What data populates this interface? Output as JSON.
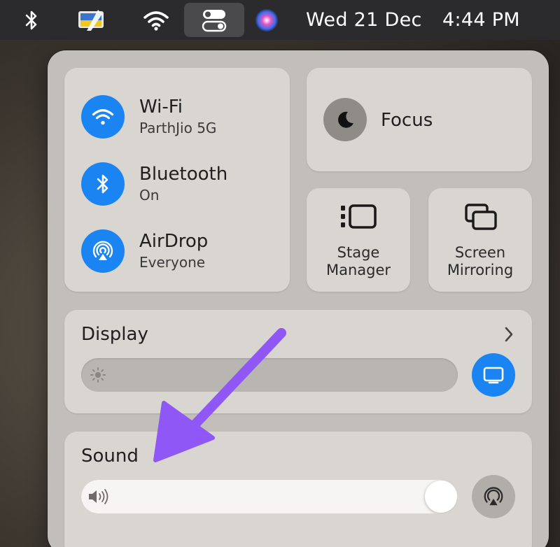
{
  "menubar": {
    "date": "Wed 21 Dec",
    "time": "4:44 PM",
    "icons": [
      "bluetooth-icon",
      "finder-flag-icon",
      "wifi-icon",
      "control-center-icon",
      "siri-icon"
    ]
  },
  "connectivity": {
    "wifi": {
      "title": "Wi-Fi",
      "subtitle": "ParthJio 5G",
      "enabled": true
    },
    "bluetooth": {
      "title": "Bluetooth",
      "subtitle": "On",
      "enabled": true
    },
    "airdrop": {
      "title": "AirDrop",
      "subtitle": "Everyone",
      "enabled": true
    }
  },
  "focus": {
    "label": "Focus"
  },
  "stage_manager": {
    "line1": "Stage",
    "line2": "Manager"
  },
  "screen_mirroring": {
    "line1": "Screen",
    "line2": "Mirroring"
  },
  "display": {
    "title": "Display",
    "brightness": 0.0
  },
  "sound": {
    "title": "Sound",
    "volume": 1.0
  },
  "colors": {
    "accent": "#1a84f2",
    "annotation_arrow": "#8f57f5"
  }
}
